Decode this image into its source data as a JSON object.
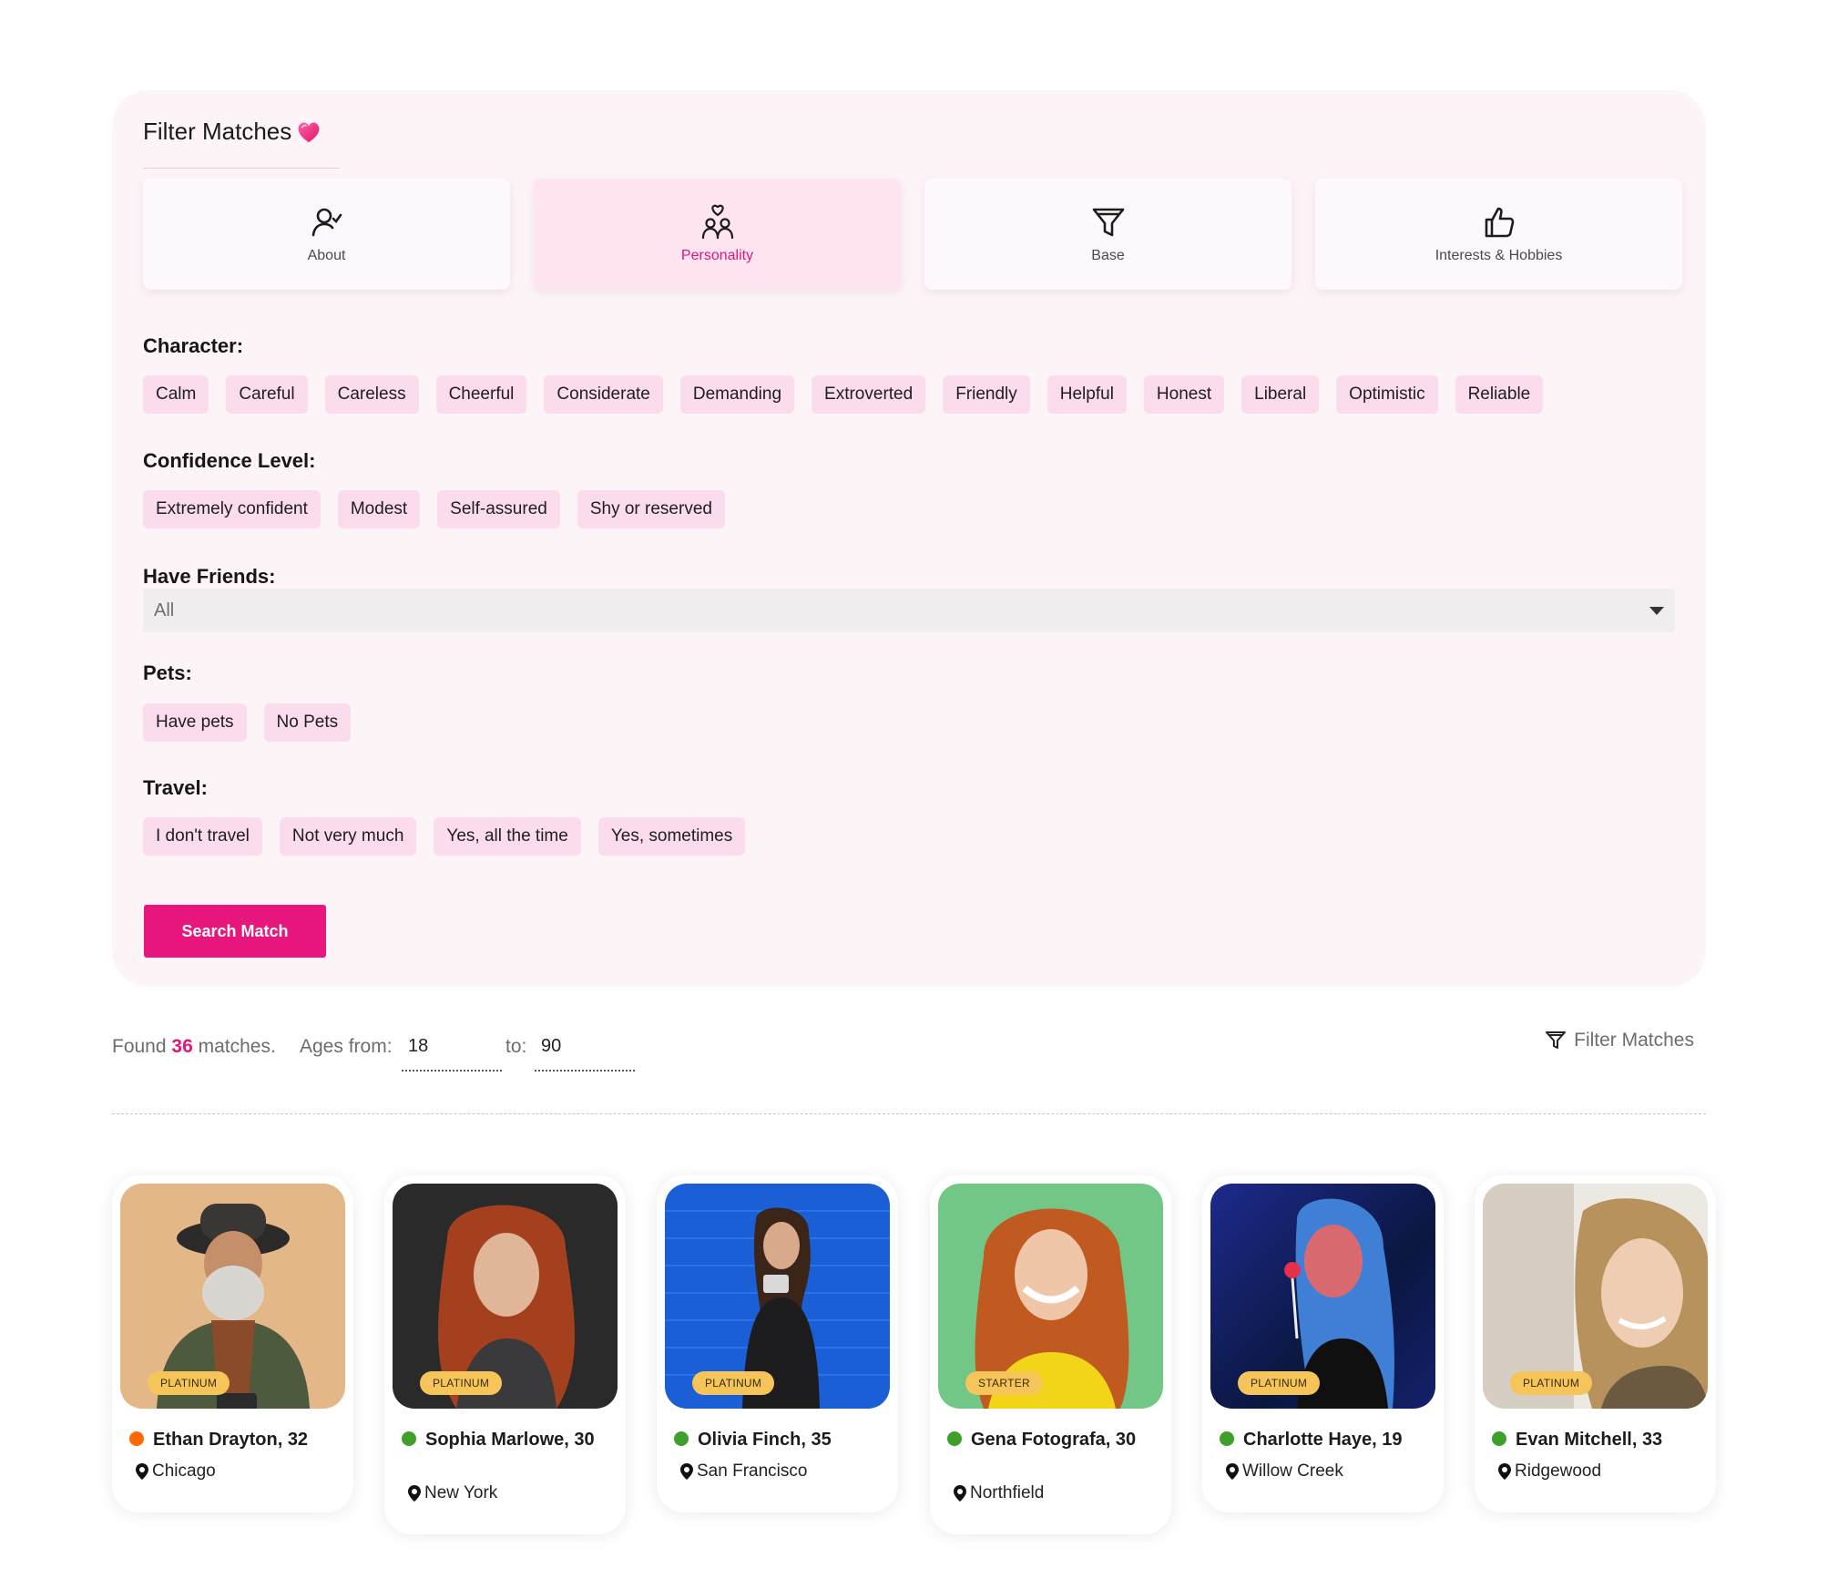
{
  "filter_panel": {
    "title": "Filter Matches",
    "tabs": [
      {
        "label": "About",
        "icon": "user-check-icon",
        "active": false
      },
      {
        "label": "Personality",
        "icon": "couple-heart-icon",
        "active": true
      },
      {
        "label": "Base",
        "icon": "funnel-icon",
        "active": false
      },
      {
        "label": "Interests & Hobbies",
        "icon": "thumbs-up-icon",
        "active": false
      }
    ],
    "character": {
      "label": "Character:",
      "options": [
        "Calm",
        "Careful",
        "Careless",
        "Cheerful",
        "Considerate",
        "Demanding",
        "Extroverted",
        "Friendly",
        "Helpful",
        "Honest",
        "Liberal",
        "Optimistic",
        "Reliable"
      ]
    },
    "confidence": {
      "label": "Confidence Level:",
      "options": [
        "Extremely confident",
        "Modest",
        "Self-assured",
        "Shy or reserved"
      ]
    },
    "friends": {
      "label": "Have Friends:",
      "selected": "All"
    },
    "pets": {
      "label": "Pets:",
      "options": [
        "Have pets",
        "No Pets"
      ]
    },
    "travel": {
      "label": "Travel:",
      "options": [
        "I don't travel",
        "Not very much",
        "Yes, all the time",
        "Yes, sometimes"
      ]
    },
    "search_button": "Search Match"
  },
  "results": {
    "found_prefix": "Found",
    "count": "36",
    "found_suffix": "matches.",
    "ages_from_label": "Ages from:",
    "age_from": "18",
    "to_label": "to:",
    "age_to": "90",
    "filter_link": "Filter Matches"
  },
  "profiles": [
    {
      "name": "Ethan Drayton",
      "age": "32",
      "city": "Chicago",
      "plan": "PLATINUM",
      "status": "offline"
    },
    {
      "name": "Sophia Marlowe",
      "age": "30",
      "city": "New York",
      "plan": "PLATINUM",
      "status": "online"
    },
    {
      "name": "Olivia Finch",
      "age": "35",
      "city": "San Francisco",
      "plan": "PLATINUM",
      "status": "online"
    },
    {
      "name": "Gena Fotografa",
      "age": "30",
      "city": "Northfield",
      "plan": "STARTER",
      "status": "online"
    },
    {
      "name": "Charlotte Haye",
      "age": "19",
      "city": "Willow Creek",
      "plan": "PLATINUM",
      "status": "online"
    },
    {
      "name": "Evan Mitchell",
      "age": "33",
      "city": "Ridgewood",
      "plan": "PLATINUM",
      "status": "online"
    }
  ],
  "colors": {
    "accent": "#e8177e",
    "chip": "#fbdcec",
    "panel": "#fdf4f8",
    "badge": "#f6c55a",
    "online": "#3ea02a",
    "offline": "#ff6a00"
  }
}
